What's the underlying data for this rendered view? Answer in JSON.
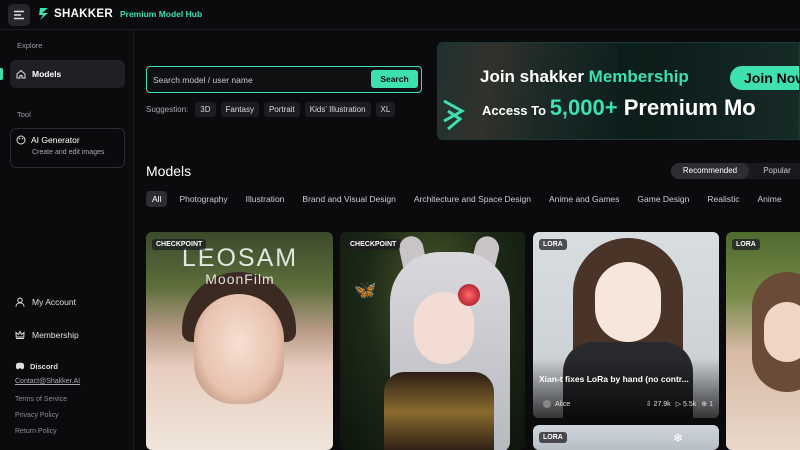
{
  "app": {
    "logo_name": "SHAKKER",
    "logo_sub": "Premium Model Hub",
    "accent_color": "#3ee0b0"
  },
  "sidebar": {
    "explore_label": "Explore",
    "models_label": "Models",
    "tool_label": "Tool",
    "ai_generator_title": "AI Generator",
    "ai_generator_sub": "Create and edit images",
    "account_label": "My Account",
    "membership_label": "Membership",
    "discord_label": "Discord",
    "contact": "Contact@Shakker.AI",
    "terms": "Terms of Service",
    "privacy": "Privacy Policy",
    "return_policy": "Return Policy"
  },
  "search": {
    "placeholder": "Search model / user name",
    "button_label": "Search",
    "suggestion_label": "Suggestion:",
    "suggestions": [
      "3D",
      "Fantasy",
      "Portrait",
      "Kids' Illustration",
      "XL"
    ]
  },
  "banner": {
    "line1_prefix": "Join shakker ",
    "line1_highlight": "Membership",
    "join_button": "Join Now",
    "line2_prefix": "Access To ",
    "line2_number": "5,000+",
    "line2_suffix": " Premium Mo"
  },
  "models": {
    "title": "Models",
    "sort_options": [
      "Recommended",
      "Popular"
    ],
    "categories": [
      "All",
      "Photography",
      "Illustration",
      "Brand and Visual Design",
      "Architecture and Space Design",
      "Anime and Games",
      "Game Design",
      "Realistic",
      "Anime"
    ],
    "cards": [
      {
        "badge": "CHECKPOINT",
        "watermark_1": "LEOSAM",
        "watermark_2": "MoonFilm"
      },
      {
        "badge": "CHECKPOINT"
      },
      {
        "badge": "LORA",
        "title": "Xian-t fixes LoRa by hand (no contr...",
        "author": "Alice",
        "downloads": "27.9k",
        "likes": "5.5k",
        "comments": "1"
      },
      {
        "badge": "LORA"
      },
      {
        "badge": "LORA"
      }
    ]
  }
}
